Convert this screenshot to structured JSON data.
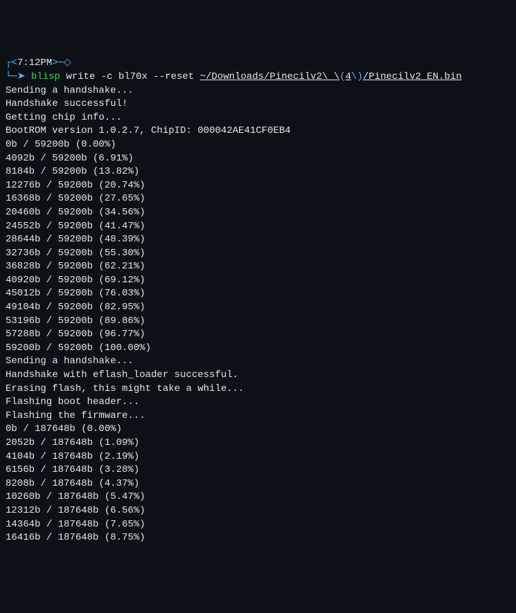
{
  "prompt": {
    "open_bracket": "┌<",
    "time": "7:12PM",
    "close_bracket": ">─◇",
    "arrow": "└─➤ ",
    "cmd": "blisp",
    "args_pre": " write -c bl70x --reset ",
    "path1": "~/Downloads/Pinecilv2\\ \\",
    "paren_open": "(",
    "path_num": "4",
    "paren_close": "\\)",
    "path2": "/Pinecilv2_EN.bin"
  },
  "output": [
    "Sending a handshake...",
    "Handshake successful!",
    "Getting chip info...",
    "BootROM version 1.0.2.7, ChipID: 000042AE41CF0EB4",
    "0b / 59200b (0.00%)",
    "4092b / 59200b (6.91%)",
    "8184b / 59200b (13.82%)",
    "12276b / 59200b (20.74%)",
    "16368b / 59200b (27.65%)",
    "20460b / 59200b (34.56%)",
    "24552b / 59200b (41.47%)",
    "28644b / 59200b (48.39%)",
    "32736b / 59200b (55.30%)",
    "36828b / 59200b (62.21%)",
    "40920b / 59200b (69.12%)",
    "45012b / 59200b (76.03%)",
    "49104b / 59200b (82.95%)",
    "53196b / 59200b (89.86%)",
    "57288b / 59200b (96.77%)",
    "59200b / 59200b (100.00%)",
    "Sending a handshake...",
    "Handshake with eflash_loader successful.",
    "Erasing flash, this might take a while...",
    "Flashing boot header...",
    "Flashing the firmware...",
    "0b / 187648b (0.00%)",
    "2052b / 187648b (1.09%)",
    "4104b / 187648b (2.19%)",
    "6156b / 187648b (3.28%)",
    "8208b / 187648b (4.37%)",
    "10260b / 187648b (5.47%)",
    "12312b / 187648b (6.56%)",
    "14364b / 187648b (7.65%)",
    "16416b / 187648b (8.75%)"
  ]
}
